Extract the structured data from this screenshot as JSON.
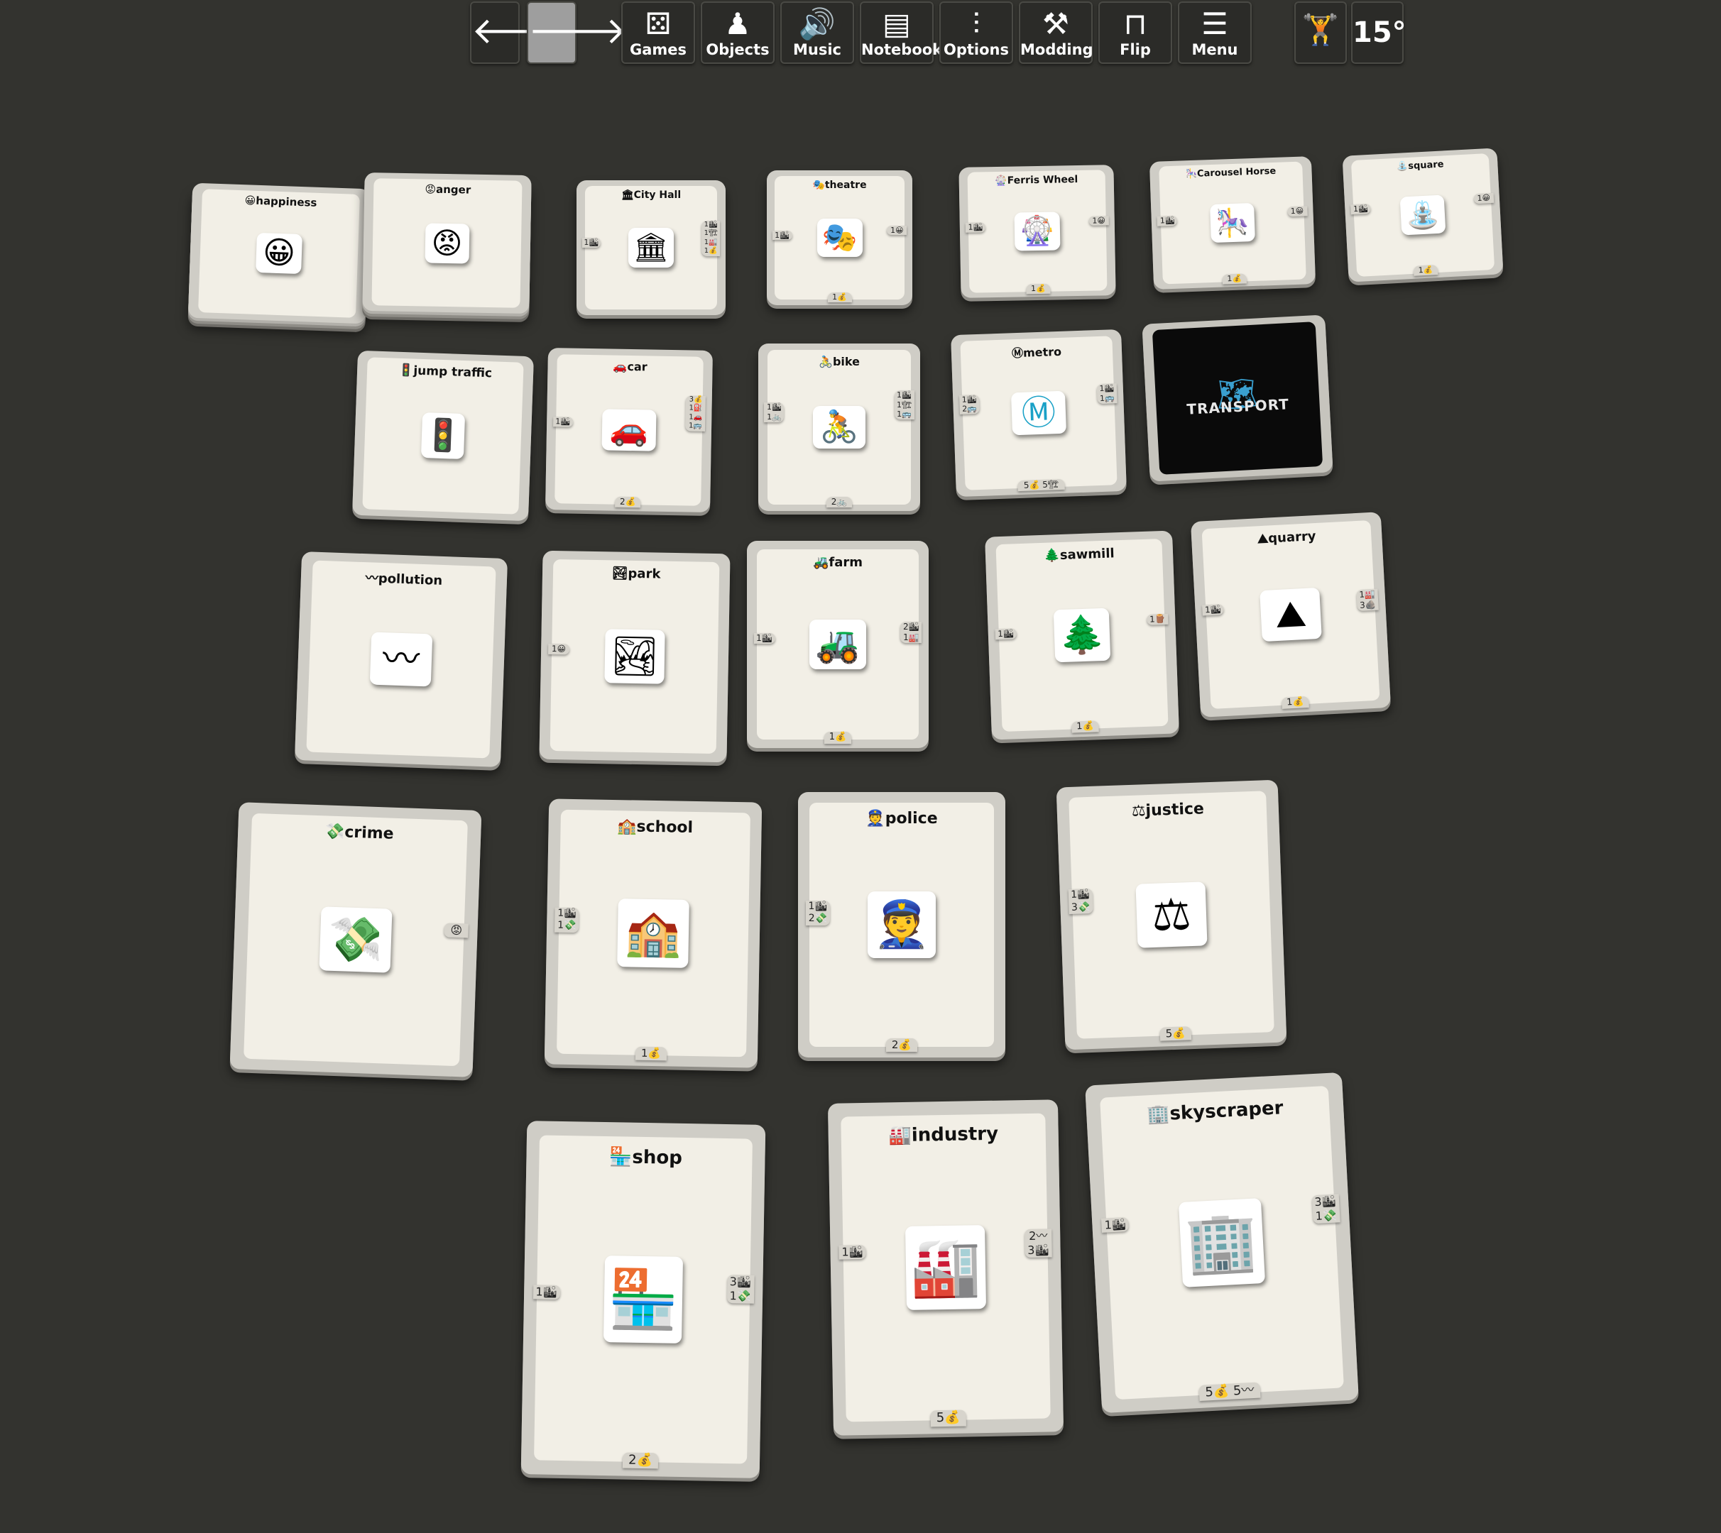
{
  "toolbar": {
    "nav_back": "🡐",
    "nav_forward": "🡒",
    "buttons": [
      {
        "label": "Games",
        "icon": "⚄"
      },
      {
        "label": "Objects",
        "icon": "♟"
      },
      {
        "label": "Music",
        "icon": "🔊"
      },
      {
        "label": "Notebook",
        "icon": "▤"
      },
      {
        "label": "Options",
        "icon": "⫶"
      },
      {
        "label": "Modding",
        "icon": "⚒"
      },
      {
        "label": "Flip",
        "icon": "⊓"
      },
      {
        "label": "Menu",
        "icon": "☰"
      }
    ],
    "pose_icon": "🏋",
    "rotation": "15°"
  },
  "cards": {
    "happiness": {
      "title": "😀happiness",
      "art": "😀"
    },
    "anger": {
      "title": "😡anger",
      "art": "😡"
    },
    "city_hall": {
      "title": "🏛City Hall",
      "art": "🏛",
      "left": "1🏙",
      "right": "1🏙\n1🏗\n1🏭\n1💰"
    },
    "theatre": {
      "title": "🎭theatre",
      "art": "🎭",
      "left": "1🏙",
      "right": "1😀",
      "bottom": "1💰"
    },
    "ferris_wheel": {
      "title": "🎡Ferris Wheel",
      "art": "🎡",
      "left": "1🏙",
      "right": "1😀",
      "bottom": "1💰"
    },
    "carousel_horse": {
      "title": "🎠Carousel Horse",
      "art": "🎠",
      "left": "1🏙",
      "right": "1😀",
      "bottom": "1💰"
    },
    "square": {
      "title": "⛲square",
      "art": "⛲",
      "left": "1🏙",
      "right": "1😀",
      "bottom": "1💰"
    },
    "jump_traffic": {
      "title": "🚦jump traffic",
      "art": "🚦"
    },
    "car": {
      "title": "🚗car",
      "art": "🚗",
      "left": "1🏙",
      "right": "3💰\n1⛽\n1🚗\n1🚌",
      "bottom": "2💰"
    },
    "bike": {
      "title": "🚴bike",
      "art": "🚴",
      "left": "1🏙\n1🚲",
      "right": "1🏙\n1🏗\n1🚌",
      "bottom": "2🚲"
    },
    "metro": {
      "title": "Ⓜmetro",
      "art": "Ⓜ",
      "left": "1🏙\n2🚌",
      "right": "1🏙\n1🚌",
      "bottom": "5💰 5🏗"
    },
    "transport": {
      "label": "TRANSPORT",
      "icon": "🗺"
    },
    "pollution": {
      "title": "〰pollution",
      "art": "〰"
    },
    "park": {
      "title": "🏞park",
      "art": "🏞",
      "left": "1😀"
    },
    "farm": {
      "title": "🚜farm",
      "art": "🚜",
      "left": "1🏙",
      "right": "2🏙\n1🏭",
      "bottom": "1💰"
    },
    "sawmill": {
      "title": "🌲sawmill",
      "art": "🌲",
      "left": "1🏙",
      "right": "1🪵",
      "bottom": "1💰"
    },
    "quarry": {
      "title": "⛰quarry",
      "art": "⛰",
      "left": "1🏙",
      "right": "1🏭\n3🪨",
      "bottom": "1💰"
    },
    "crime": {
      "title": "💸crime",
      "art": "💸",
      "right": "😡"
    },
    "school": {
      "title": "🏫school",
      "art": "🏫",
      "left": "1🏙\n1💸",
      "bottom": "1💰"
    },
    "police": {
      "title": "👮police",
      "art": "👮",
      "left": "1🏙\n2💸",
      "bottom": "2💰"
    },
    "justice": {
      "title": "⚖justice",
      "art": "⚖",
      "left": "1🏙\n3💸",
      "bottom": "5💰"
    },
    "shop": {
      "title": "🏪shop",
      "art": "🏪",
      "left": "1🏙",
      "right": "3🏙\n1💸",
      "bottom": "2💰"
    },
    "industry": {
      "title": "🏭industry",
      "art": "🏭",
      "left": "1🏙",
      "right": "2〰\n3🏙",
      "bottom": "5💰"
    },
    "skyscraper": {
      "title": "🏢skyscraper",
      "art": "🏢",
      "left": "1🏙",
      "right": "3🏙\n1💸",
      "bottom": "5💰 5〰"
    }
  }
}
